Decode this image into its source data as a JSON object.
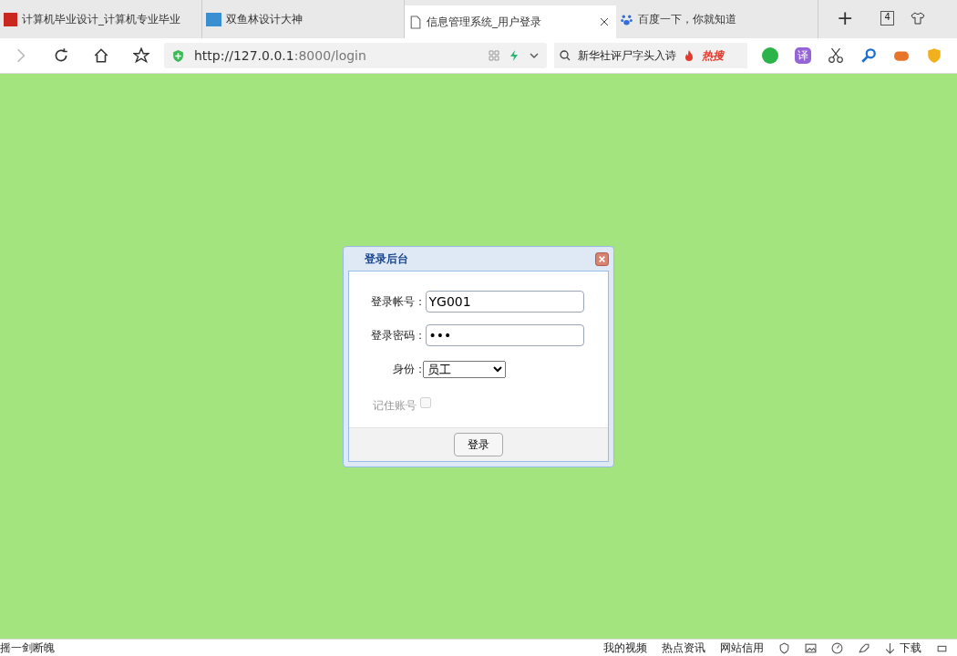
{
  "browser": {
    "tabs": [
      {
        "title": "计算机毕业设计_计算机专业毕业",
        "kind": "logo",
        "selected": false
      },
      {
        "title": "双鱼林设计大神",
        "kind": "live",
        "selected": false
      },
      {
        "title": "信息管理系统_用户登录",
        "kind": "page",
        "selected": true
      },
      {
        "title": "百度一下，你就知道",
        "kind": "paw",
        "selected": false
      }
    ],
    "tab_count": "4",
    "new_tab": "+",
    "url": {
      "host": "http://127.0.0.1",
      "rest": ":8000/login"
    },
    "search": {
      "value": "新华社评尸字头入诗",
      "hot": "热搜"
    },
    "translate": "译"
  },
  "dialog": {
    "title": "登录后台",
    "fields": [
      {
        "label": "登录帐号：",
        "kind": "text",
        "value": "YG001"
      },
      {
        "label": "登录密码：",
        "kind": "password",
        "value": "•••"
      },
      {
        "label": "身份：",
        "kind": "select",
        "value": "员工"
      }
    ],
    "remember": {
      "label": "记住账号",
      "checked": false,
      "disabled": true
    },
    "submit": "登录"
  },
  "status_bar": {
    "left": "摇一剑断魄",
    "items": [
      "我的视频",
      "热点资讯",
      "网站信用"
    ],
    "download": "下载"
  }
}
